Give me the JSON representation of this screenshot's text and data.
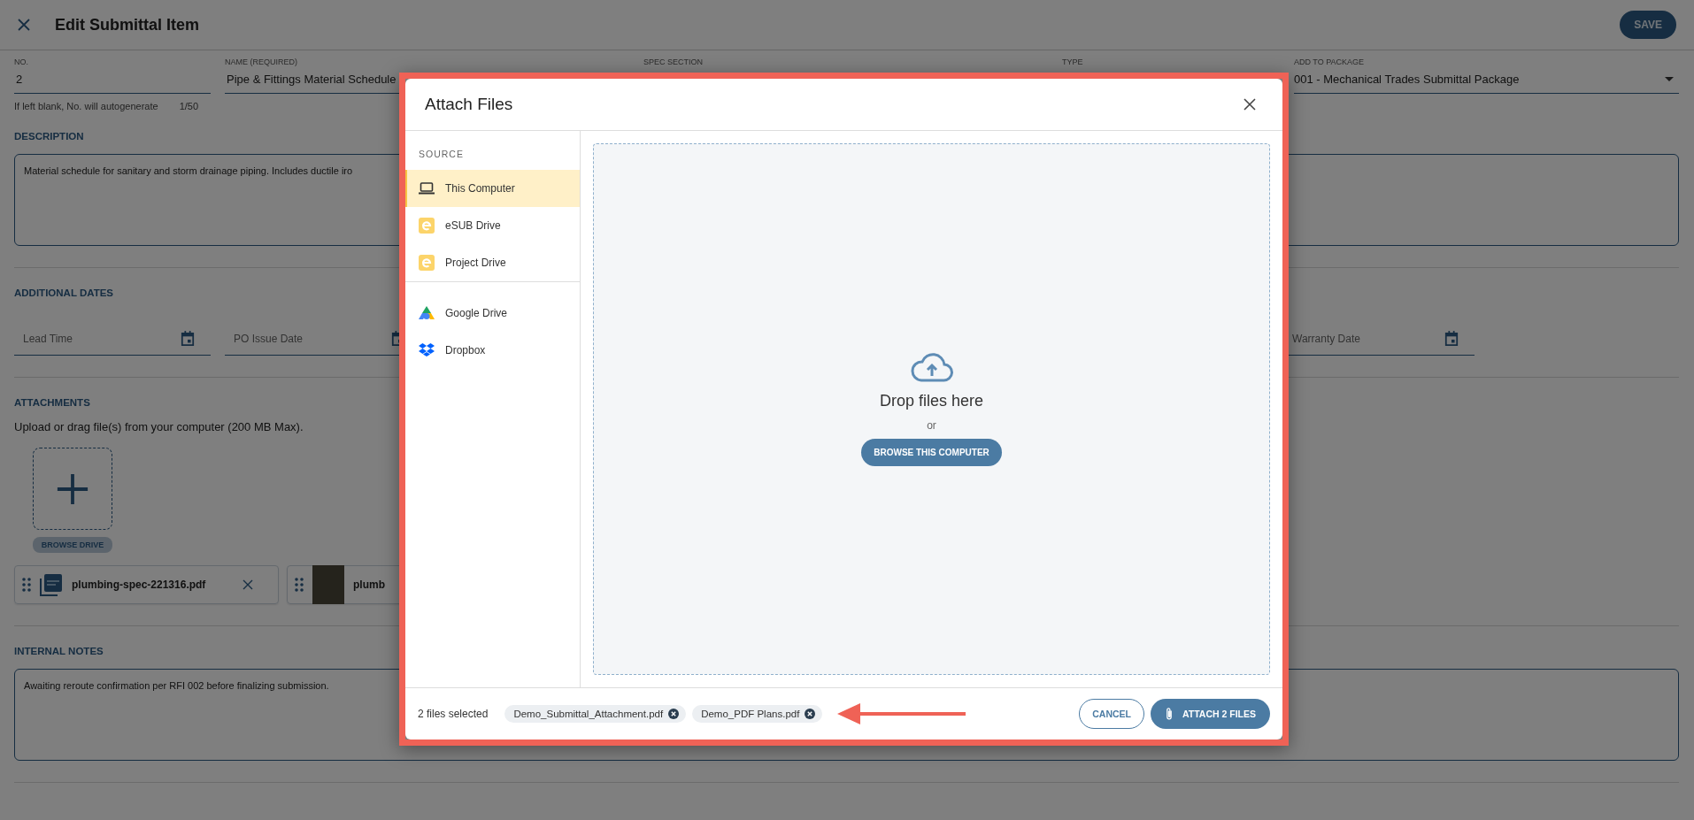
{
  "header": {
    "title": "Edit Submittal Item",
    "save_button": "SAVE"
  },
  "fields": [
    {
      "label": "NO.",
      "value": "2",
      "kind": "text"
    },
    {
      "label": "NAME (REQUIRED)",
      "value": "Pipe & Fittings Material Schedule",
      "kind": "text"
    },
    {
      "label": "SPEC SECTION",
      "kind": "text"
    },
    {
      "label": "TYPE",
      "kind": "select"
    },
    {
      "label": "ADD TO PACKAGE",
      "value": "001 - Mechanical Trades Submittal Package",
      "kind": "select"
    }
  ],
  "no_hint": "If left blank, No. will autogenerate",
  "no_counter": "1/50",
  "description": {
    "label": "DESCRIPTION",
    "value": "Material schedule for sanitary and storm drainage piping. Includes ductile iro"
  },
  "additional_dates": {
    "label": "ADDITIONAL DATES",
    "fields": [
      {
        "placeholder": "Lead Time"
      },
      {
        "placeholder": "PO Issue Date"
      },
      {
        "placeholder": "Warranty Date"
      }
    ]
  },
  "attachments": {
    "label": "ATTACHMENTS",
    "hint": "Upload or drag file(s) from your computer (200 MB Max).",
    "browse_button": "BROWSE DRIVE",
    "files": [
      {
        "name": "plumbing-spec-221316.pdf",
        "kind": "pdf"
      },
      {
        "name": "plumb",
        "kind": "image"
      }
    ]
  },
  "internal_notes": {
    "label": "INTERNAL NOTES",
    "value": "Awaiting reroute confirmation per RFI 002 before finalizing submission."
  },
  "dialog": {
    "title": "Attach Files",
    "source_label": "SOURCE",
    "source_groups": [
      {
        "items": [
          {
            "label": "This Computer",
            "kind": "computer",
            "selected": true
          },
          {
            "label": "eSUB Drive",
            "kind": "esub",
            "selected": false
          },
          {
            "label": "Project Drive",
            "kind": "esub",
            "selected": false
          }
        ]
      },
      {
        "items": [
          {
            "label": "Google Drive",
            "kind": "gdrive",
            "selected": false
          },
          {
            "label": "Dropbox",
            "kind": "dropbox",
            "selected": false
          }
        ]
      }
    ],
    "dropzone": {
      "title": "Drop files here",
      "or": "or",
      "button": "BROWSE THIS COMPUTER"
    },
    "selected_count": "2 files selected",
    "chips": [
      "Demo_Submittal_Attachment.pdf",
      "Demo_PDF Plans.pdf"
    ],
    "cancel_button": "CANCEL",
    "attach_button": "ATTACH 2 FILES"
  }
}
